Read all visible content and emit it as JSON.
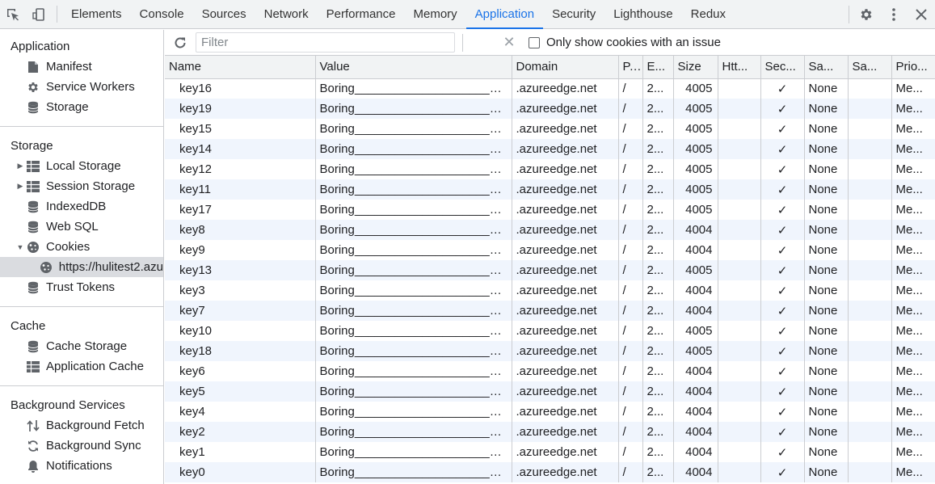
{
  "tabs": [
    "Elements",
    "Console",
    "Sources",
    "Network",
    "Performance",
    "Memory",
    "Application",
    "Security",
    "Lighthouse",
    "Redux"
  ],
  "active_tab": "Application",
  "sidebar": {
    "application": {
      "title": "Application",
      "items": [
        {
          "label": "Manifest",
          "icon": "manifest-icon"
        },
        {
          "label": "Service Workers",
          "icon": "gear-icon"
        },
        {
          "label": "Storage",
          "icon": "database-icon"
        }
      ]
    },
    "storage": {
      "title": "Storage",
      "items": [
        {
          "label": "Local Storage",
          "icon": "grid-icon",
          "expandable": true
        },
        {
          "label": "Session Storage",
          "icon": "grid-icon",
          "expandable": true
        },
        {
          "label": "IndexedDB",
          "icon": "database-icon"
        },
        {
          "label": "Web SQL",
          "icon": "database-icon"
        },
        {
          "label": "Cookies",
          "icon": "cookie-icon",
          "expanded": true
        },
        {
          "label": "https://hulitest2.azu",
          "icon": "cookie-icon",
          "child": true,
          "selected": true
        },
        {
          "label": "Trust Tokens",
          "icon": "database-icon"
        }
      ]
    },
    "cache": {
      "title": "Cache",
      "items": [
        {
          "label": "Cache Storage",
          "icon": "database-icon"
        },
        {
          "label": "Application Cache",
          "icon": "grid-icon"
        }
      ]
    },
    "background": {
      "title": "Background Services",
      "items": [
        {
          "label": "Background Fetch",
          "icon": "arrows-updown-icon"
        },
        {
          "label": "Background Sync",
          "icon": "sync-icon"
        },
        {
          "label": "Notifications",
          "icon": "bell-icon"
        }
      ]
    }
  },
  "filter": {
    "placeholder": "Filter",
    "checkbox_label": "Only show cookies with an issue"
  },
  "table": {
    "columns": [
      "Name",
      "Value",
      "Domain",
      "P...",
      "E...",
      "Size",
      "Htt...",
      "Sec...",
      "Sa...",
      "Sa...",
      "Prio..."
    ],
    "rows": [
      [
        "key16",
        "Boring___________________________________",
        ".azureedge.net",
        "/",
        "2...",
        "4005",
        "",
        "✓",
        "None",
        "",
        "Me..."
      ],
      [
        "key19",
        "Boring___________________________________",
        ".azureedge.net",
        "/",
        "2...",
        "4005",
        "",
        "✓",
        "None",
        "",
        "Me..."
      ],
      [
        "key15",
        "Boring___________________________________",
        ".azureedge.net",
        "/",
        "2...",
        "4005",
        "",
        "✓",
        "None",
        "",
        "Me..."
      ],
      [
        "key14",
        "Boring___________________________________",
        ".azureedge.net",
        "/",
        "2...",
        "4005",
        "",
        "✓",
        "None",
        "",
        "Me..."
      ],
      [
        "key12",
        "Boring___________________________________",
        ".azureedge.net",
        "/",
        "2...",
        "4005",
        "",
        "✓",
        "None",
        "",
        "Me..."
      ],
      [
        "key11",
        "Boring___________________________________",
        ".azureedge.net",
        "/",
        "2...",
        "4005",
        "",
        "✓",
        "None",
        "",
        "Me..."
      ],
      [
        "key17",
        "Boring___________________________________",
        ".azureedge.net",
        "/",
        "2...",
        "4005",
        "",
        "✓",
        "None",
        "",
        "Me..."
      ],
      [
        "key8",
        "Boring___________________________________",
        ".azureedge.net",
        "/",
        "2...",
        "4004",
        "",
        "✓",
        "None",
        "",
        "Me..."
      ],
      [
        "key9",
        "Boring___________________________________",
        ".azureedge.net",
        "/",
        "2...",
        "4004",
        "",
        "✓",
        "None",
        "",
        "Me..."
      ],
      [
        "key13",
        "Boring___________________________________",
        ".azureedge.net",
        "/",
        "2...",
        "4005",
        "",
        "✓",
        "None",
        "",
        "Me..."
      ],
      [
        "key3",
        "Boring___________________________________",
        ".azureedge.net",
        "/",
        "2...",
        "4004",
        "",
        "✓",
        "None",
        "",
        "Me..."
      ],
      [
        "key7",
        "Boring___________________________________",
        ".azureedge.net",
        "/",
        "2...",
        "4004",
        "",
        "✓",
        "None",
        "",
        "Me..."
      ],
      [
        "key10",
        "Boring___________________________________",
        ".azureedge.net",
        "/",
        "2...",
        "4005",
        "",
        "✓",
        "None",
        "",
        "Me..."
      ],
      [
        "key18",
        "Boring___________________________________",
        ".azureedge.net",
        "/",
        "2...",
        "4005",
        "",
        "✓",
        "None",
        "",
        "Me..."
      ],
      [
        "key6",
        "Boring___________________________________",
        ".azureedge.net",
        "/",
        "2...",
        "4004",
        "",
        "✓",
        "None",
        "",
        "Me..."
      ],
      [
        "key5",
        "Boring___________________________________",
        ".azureedge.net",
        "/",
        "2...",
        "4004",
        "",
        "✓",
        "None",
        "",
        "Me..."
      ],
      [
        "key4",
        "Boring___________________________________",
        ".azureedge.net",
        "/",
        "2...",
        "4004",
        "",
        "✓",
        "None",
        "",
        "Me..."
      ],
      [
        "key2",
        "Boring___________________________________",
        ".azureedge.net",
        "/",
        "2...",
        "4004",
        "",
        "✓",
        "None",
        "",
        "Me..."
      ],
      [
        "key1",
        "Boring___________________________________",
        ".azureedge.net",
        "/",
        "2...",
        "4004",
        "",
        "✓",
        "None",
        "",
        "Me..."
      ],
      [
        "key0",
        "Boring___________________________________",
        ".azureedge.net",
        "/",
        "2...",
        "4004",
        "",
        "✓",
        "None",
        "",
        "Me..."
      ]
    ]
  },
  "colors": {
    "accent": "#1a73e8",
    "row_alt": "#f0f5fd",
    "toolbar_bg": "#f1f3f4"
  }
}
